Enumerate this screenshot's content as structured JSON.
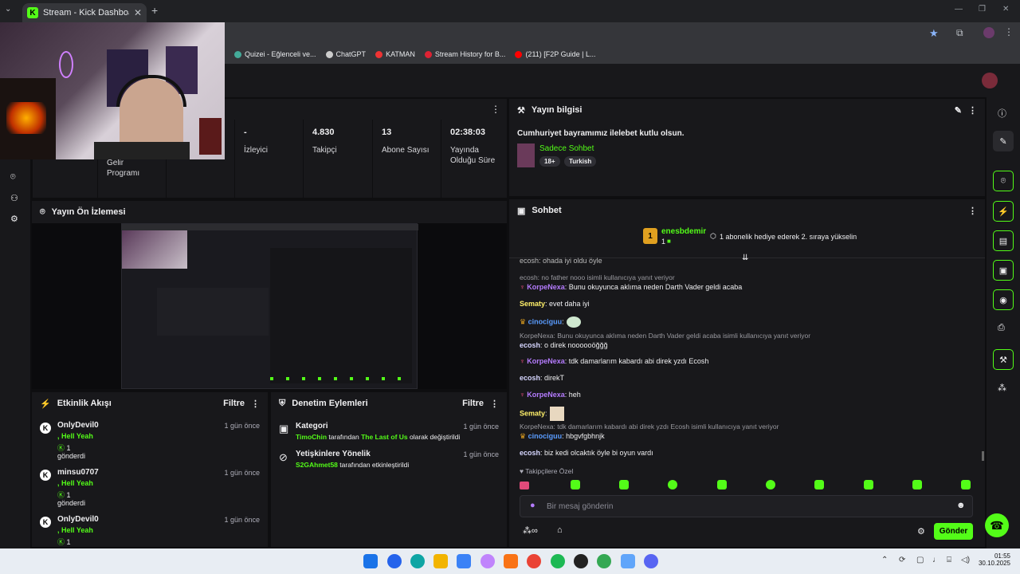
{
  "browser": {
    "tab_title": "Stream - Kick Dashboard",
    "tab_favicon": "K",
    "new_tab": "+",
    "bookmarks": [
      {
        "label": "Quizei - Eğlenceli ve...",
        "color": "#4a9"
      },
      {
        "label": "ChatGPT",
        "color": "#ccc"
      },
      {
        "label": "KATMAN",
        "color": "#e33"
      },
      {
        "label": "Stream History for B...",
        "color": "#d23"
      },
      {
        "label": "(211) [F2P Guide | L...",
        "color": "#f00"
      }
    ]
  },
  "stats": [
    {
      "value": "",
      "label": "Gelir Programı"
    },
    {
      "value": "-",
      "label": "İzleyici"
    },
    {
      "value": "4.830",
      "label": "Takipçi"
    },
    {
      "value": "13",
      "label": "Abone Sayısı"
    },
    {
      "value": "02:38:03",
      "label": "Yayında Olduğu Süre"
    }
  ],
  "stream_info": {
    "header": "Yayın bilgisi",
    "title": "Cumhuriyet bayramımız ilelebet kutlu olsun.",
    "category": "Sadece Sohbet",
    "tags": [
      "18+",
      "Turkish"
    ]
  },
  "preview": {
    "header": "Yayın Ön İzlemesi"
  },
  "chat": {
    "header": "Sohbet",
    "pinned_user": "enesbdemir",
    "pinned_rank": "1",
    "pinned_count": "1",
    "pinned_text": "1 abonelik hediye ederek 2. sıraya yükselin",
    "partial_line": "ecosh: ohada iyi oldu öyle",
    "messages": [
      {
        "type": "reply",
        "text": "ecosh: no father nooo isimli kullanıcıya yanıt veriyor"
      },
      {
        "type": "msg",
        "user": "KorpeNexa",
        "cls": "u-p",
        "text": ": Bunu okuyunca aklıma neden Darth Vader geldi acaba"
      },
      {
        "type": "msg",
        "user": "Sematy",
        "cls": "u-y",
        "text": ": evet daha iyi"
      },
      {
        "type": "msg",
        "user": "cinociguu",
        "cls": "u-b",
        "text": ":"
      },
      {
        "type": "reply",
        "text": "KorpeNexa: Bunu okuyunca aklıma neden Darth Vader geldi acaba isimli kullanıcıya yanıt veriyor"
      },
      {
        "type": "msg",
        "user": "ecosh",
        "cls": "u-w",
        "text": ": o direk noooooöğğğ"
      },
      {
        "type": "msg",
        "user": "KorpeNexa",
        "cls": "u-p",
        "text": ": tdk damarlarım kabardı abi direk yzdı Ecosh"
      },
      {
        "type": "msg",
        "user": "ecosh",
        "cls": "u-w",
        "text": ": direkT"
      },
      {
        "type": "msg",
        "user": "KorpeNexa",
        "cls": "u-p",
        "text": ": heh"
      },
      {
        "type": "msg",
        "user": "Sematy",
        "cls": "u-y",
        "text": ":"
      },
      {
        "type": "reply",
        "text": "KorpeNexa: tdk damarlarım kabardı abi direk yzdı Ecosh isimli kullanıcıya yanıt veriyor"
      },
      {
        "type": "msg",
        "user": "cinociguu",
        "cls": "u-b",
        "text": ": hbgvfgbhnjk"
      },
      {
        "type": "msg",
        "user": "ecosh",
        "cls": "u-w",
        "text": ": biz kedi olcaktık öyle bi oyun vardı"
      }
    ],
    "followers_only": "Takipçilere Özel",
    "input_placeholder": "Bir mesaj gönderin",
    "send_label": "Gönder"
  },
  "activity": {
    "header": "Etkinlik Akışı",
    "filter": "Filtre",
    "items": [
      {
        "user": "OnlyDevil0",
        "time": "1 gün önce",
        "l1": ", Hell Yeah",
        "l2": "1",
        "l3": "gönderdi"
      },
      {
        "user": "minsu0707",
        "time": "1 gün önce",
        "l1": ", Hell Yeah",
        "l2": "1",
        "l3": "gönderdi"
      },
      {
        "user": "OnlyDevil0",
        "time": "1 gün önce",
        "l1": ", Hell Yeah",
        "l2": "1",
        "l3": ""
      }
    ]
  },
  "moderation": {
    "header": "Denetim Eylemleri",
    "filter": "Filtre",
    "items": [
      {
        "title": "Kategori",
        "time": "1 gün önce",
        "user": "TimoChin",
        "mid": " tarafından ",
        "target": "The Last of Us",
        "end": " olarak değiştirildi"
      },
      {
        "title": "Yetişkinlere Yönelik",
        "time": "1 gün önce",
        "user": "S2GAhmet58",
        "mid": " tarafından etkinleştirildi",
        "target": "",
        "end": ""
      }
    ]
  },
  "taskbar": {
    "time": "01:55",
    "date": "30.10.2025"
  },
  "colors": {
    "accent": "#53fc18",
    "bg": "#0e0e10",
    "panel": "#18181b"
  }
}
